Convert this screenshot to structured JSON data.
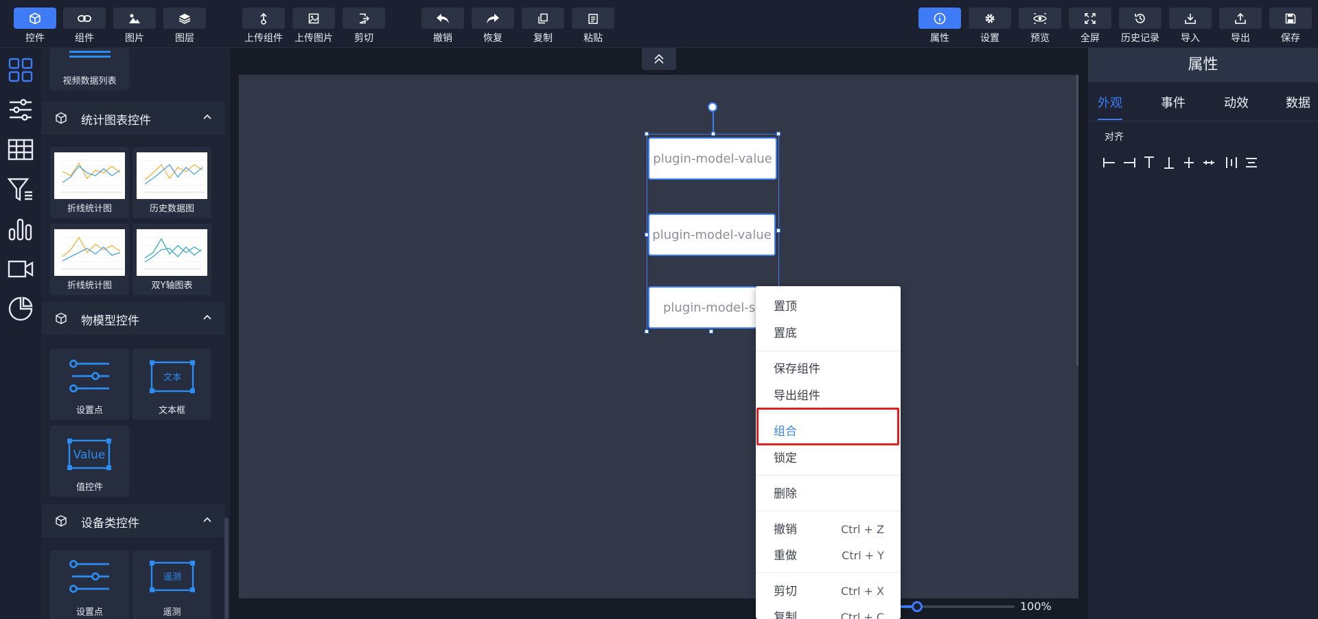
{
  "toolbar": {
    "left": [
      {
        "label": "控件",
        "icon": "cube-icon",
        "active": true
      },
      {
        "label": "组件",
        "icon": "link-icon"
      },
      {
        "label": "图片",
        "icon": "image-icon"
      },
      {
        "label": "图层",
        "icon": "layers-icon"
      }
    ],
    "middle1": [
      {
        "label": "上传组件",
        "icon": "upload-component-icon"
      },
      {
        "label": "上传图片",
        "icon": "upload-image-icon"
      },
      {
        "label": "剪切",
        "icon": "cut-icon"
      }
    ],
    "middle2": [
      {
        "label": "撤销",
        "icon": "undo-icon"
      },
      {
        "label": "恢复",
        "icon": "redo-icon"
      },
      {
        "label": "复制",
        "icon": "copy-icon"
      },
      {
        "label": "粘贴",
        "icon": "paste-icon"
      }
    ],
    "right": [
      {
        "label": "属性",
        "icon": "info-icon",
        "active": true
      },
      {
        "label": "设置",
        "icon": "gear-icon"
      },
      {
        "label": "预览",
        "icon": "eye-icon"
      },
      {
        "label": "全屏",
        "icon": "fullscreen-icon"
      },
      {
        "label": "历史记录",
        "icon": "history-icon"
      },
      {
        "label": "导入",
        "icon": "download-icon"
      },
      {
        "label": "导出",
        "icon": "upload-icon"
      },
      {
        "label": "保存",
        "icon": "save-icon"
      }
    ]
  },
  "rail": [
    "grid-icon",
    "sliders-icon",
    "table-icon",
    "filter-icon",
    "bar-chart-icon",
    "video-icon",
    "pie-chart-icon"
  ],
  "panel": {
    "top_card": "视频数据列表",
    "sections": [
      {
        "title": "统计图表控件",
        "cards": [
          "折线统计图",
          "历史数据图",
          "折线统计图",
          "双Y轴图表"
        ]
      },
      {
        "title": "物模型控件",
        "cards": [
          "设置点",
          "文本框",
          "值控件"
        ]
      },
      {
        "title": "设备类控件",
        "cards": [
          "设置点",
          "遥测"
        ]
      }
    ],
    "thumb_text": {
      "textbox": "文本",
      "value": "Value",
      "telemetry": "遥测"
    }
  },
  "canvas": {
    "widgets": [
      "plugin-model-value",
      "plugin-model-value",
      "plugin-model-se"
    ]
  },
  "zoom": {
    "value": "100%",
    "level": 0.2
  },
  "context_menu": {
    "items": [
      {
        "label": "置顶"
      },
      {
        "label": "置底"
      },
      {
        "label": "保存组件"
      },
      {
        "label": "导出组件"
      },
      {
        "label": "组合",
        "highlighted": true
      },
      {
        "label": "锁定"
      },
      {
        "label": "删除"
      },
      {
        "label": "撤销",
        "shortcut": "Ctrl + Z"
      },
      {
        "label": "重做",
        "shortcut": "Ctrl + Y"
      },
      {
        "label": "剪切",
        "shortcut": "Ctrl + X"
      },
      {
        "label": "复制",
        "shortcut": "Ctrl + C"
      }
    ]
  },
  "props": {
    "title": "属性",
    "tabs": [
      "外观",
      "事件",
      "动效",
      "数据"
    ],
    "align_label": "对齐"
  },
  "colors": {
    "accent": "#3f7bf6",
    "highlight_border": "#e02020",
    "bg": "#141821"
  }
}
